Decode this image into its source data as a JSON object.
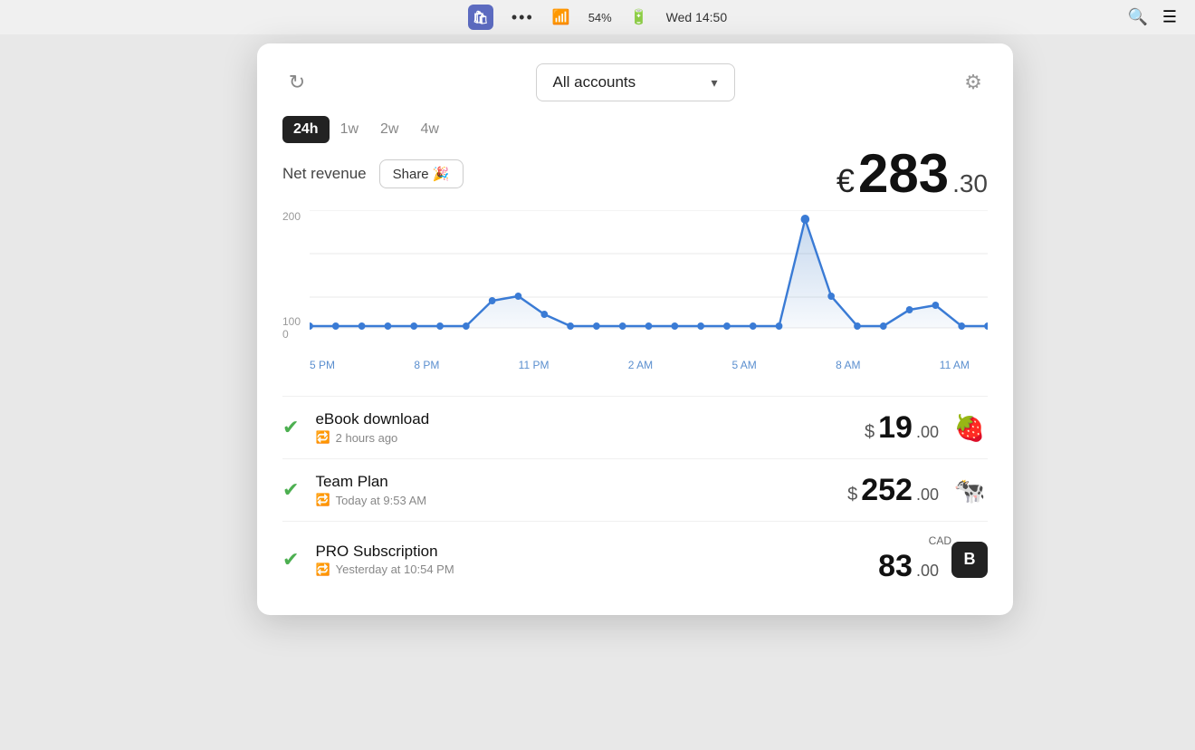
{
  "menubar": {
    "app_icon": "🛍",
    "dots": "•••",
    "battery_percent": "54%",
    "time": "Wed 14:50",
    "search_icon": "search",
    "menu_icon": "menu"
  },
  "header": {
    "refresh_label": "↻",
    "accounts_label": "All accounts",
    "chevron": "▾",
    "gear_label": "⚙"
  },
  "time_tabs": [
    {
      "label": "24h",
      "active": true
    },
    {
      "label": "1w",
      "active": false
    },
    {
      "label": "2w",
      "active": false
    },
    {
      "label": "4w",
      "active": false
    }
  ],
  "revenue": {
    "label": "Net revenue",
    "share_label": "Share 🎉",
    "currency_symbol": "€",
    "main_amount": "283",
    "cents": ".30"
  },
  "chart": {
    "y_labels": [
      "200",
      "100",
      "0"
    ],
    "x_labels": [
      "5 PM",
      "8 PM",
      "11 PM",
      "2 AM",
      "5 AM",
      "8 AM",
      "11 AM"
    ]
  },
  "transactions": [
    {
      "name": "eBook download",
      "time": "2 hours ago",
      "currency": "$",
      "amount": "19",
      "cents": ".00",
      "currency_code": null,
      "icon": "🍓",
      "icon_type": "emoji"
    },
    {
      "name": "Team Plan",
      "time": "Today at 9:53 AM",
      "currency": "$",
      "amount": "252",
      "cents": ".00",
      "currency_code": null,
      "icon": "🐄",
      "icon_type": "emoji"
    },
    {
      "name": "PRO Subscription",
      "time": "Yesterday at 10:54 PM",
      "currency": "",
      "amount": "83",
      "cents": ".00",
      "currency_code": "CAD",
      "icon": "B",
      "icon_type": "dark"
    }
  ]
}
